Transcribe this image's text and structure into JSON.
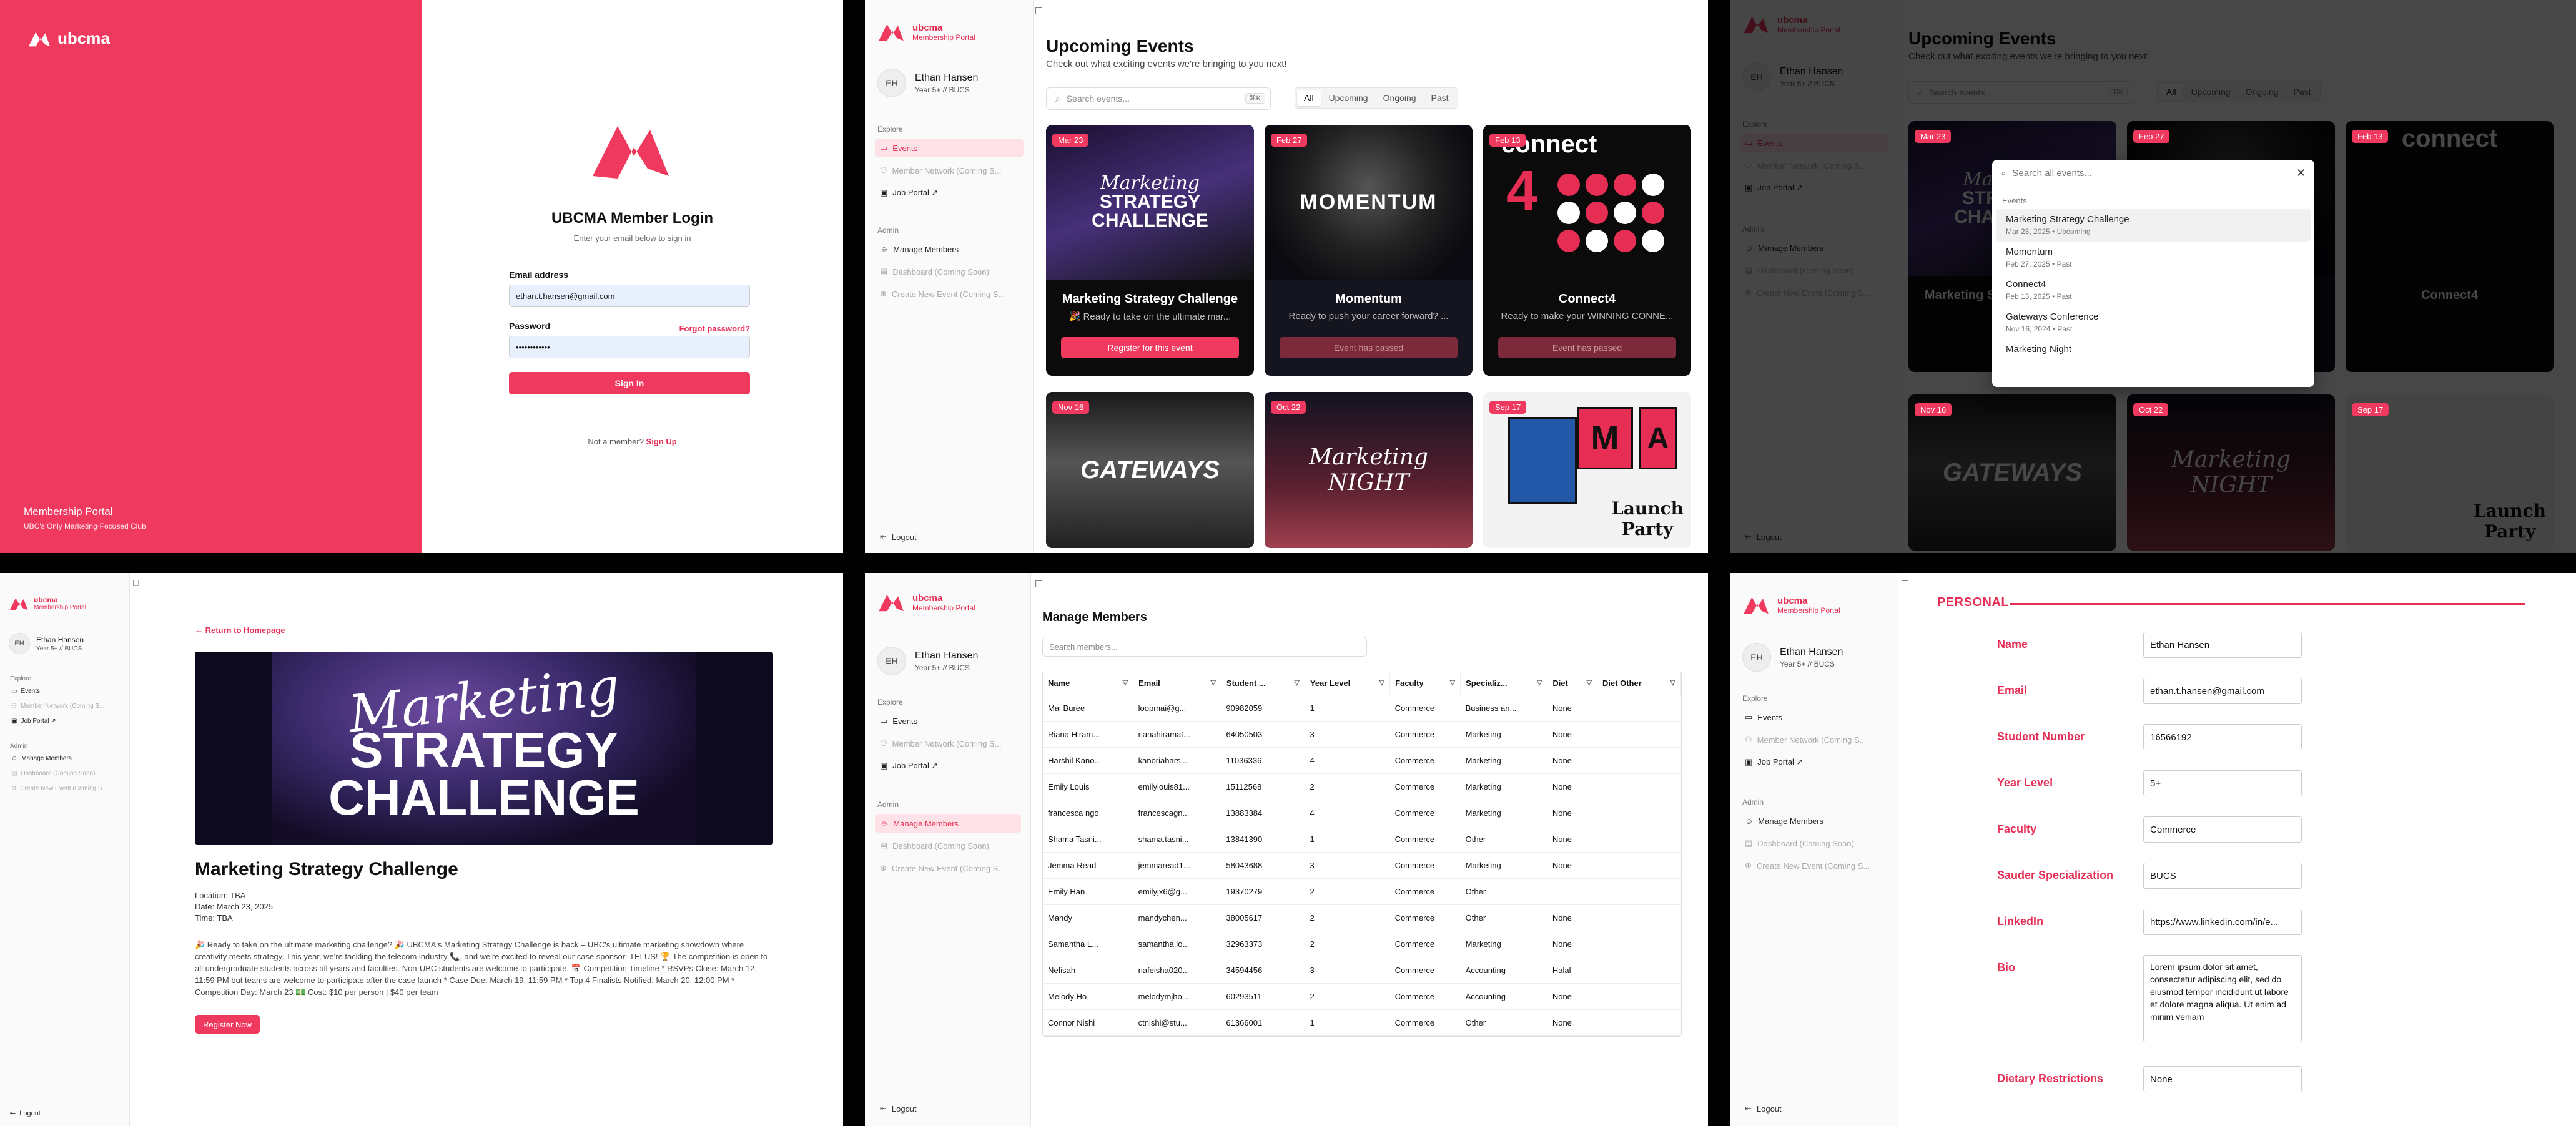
{
  "brand": {
    "name": "ubcma",
    "portal": "Membership Portal"
  },
  "colors": {
    "accent": "#f0395e"
  },
  "login": {
    "tagline_title": "Membership Portal",
    "tagline_sub": "UBC's Only Marketing-Focused Club",
    "title": "UBCMA Member Login",
    "subtitle": "Enter your email below to sign in",
    "email_label": "Email address",
    "email_value": "ethan.t.hansen@gmail.com",
    "password_label": "Password",
    "password_value": "••••••••••••",
    "forgot": "Forgot password?",
    "sign_in": "Sign In",
    "not_member": "Not a member?",
    "sign_up": "Sign Up"
  },
  "user": {
    "initials": "EH",
    "name": "Ethan Hansen",
    "sub": "Year 5+ // BUCS"
  },
  "nav": {
    "explore": "Explore",
    "events": "Events",
    "network": "Member Network (Coming S...",
    "jobs": "Job Portal ↗",
    "admin": "Admin",
    "manage": "Manage Members",
    "dashboard": "Dashboard (Coming Soon)",
    "create": "Create New Event (Coming S...",
    "logout": "Logout"
  },
  "events_page": {
    "title": "Upcoming Events",
    "subtitle": "Check out what exciting events we're bringing to you next!",
    "search_placeholder": "Search events...",
    "shortcut": "⌘K",
    "filters": [
      "All",
      "Upcoming",
      "Ongoing",
      "Past"
    ],
    "cards": [
      {
        "date": "Mar 23",
        "title": "Marketing Strategy Challenge",
        "desc": "🎉 Ready to take on the ultimate mar...",
        "button": "Register for this event",
        "art": "Marketing STRATEGY CHALLENGE"
      },
      {
        "date": "Feb 27",
        "title": "Momentum",
        "desc": "Ready to push your career forward? ...",
        "button": "Event has passed",
        "art": "MOMENTUM"
      },
      {
        "date": "Feb 13",
        "title": "Connect4",
        "desc": "Ready to make your WINNING CONNE...",
        "button": "Event has passed",
        "art": "connect 4"
      },
      {
        "date": "Nov 16",
        "art": "GATEWAYS"
      },
      {
        "date": "Oct 22",
        "art": "Marketing NIGHT"
      },
      {
        "date": "Sep 17",
        "art": "Launch Party"
      }
    ]
  },
  "search_modal": {
    "placeholder": "Search all events...",
    "section": "Events",
    "items": [
      {
        "title": "Marketing Strategy Challenge",
        "meta": "Mar 23, 2025 • Upcoming"
      },
      {
        "title": "Momentum",
        "meta": "Feb 27, 2025 • Past"
      },
      {
        "title": "Connect4",
        "meta": "Feb 13, 2025 • Past"
      },
      {
        "title": "Gateways Conference",
        "meta": "Nov 16, 2024 • Past"
      },
      {
        "title": "Marketing Night",
        "meta": ""
      }
    ]
  },
  "detail": {
    "back": "← Return to Homepage",
    "banner_script": "Marketing",
    "banner_block1": "STRATEGY",
    "banner_block2": "CHALLENGE",
    "title": "Marketing Strategy Challenge",
    "location": "Location: TBA",
    "date": "Date: March 23, 2025",
    "time": "Time: TBA",
    "description": "🎉 Ready to take on the ultimate marketing challenge? 🎉 UBCMA's Marketing Strategy Challenge is back – UBC's ultimate marketing showdown where creativity meets strategy. This year, we're tackling the telecom industry 📞, and we're excited to reveal our case sponsor: TELUS! 🏆 The competition is open to all undergraduate students across all years and faculties. Non-UBC students are welcome to participate. 📅 Competition Timeline * RSVPs Close: March 12, 11:59 PM but teams are welcome to participate after the case launch * Case Due: March 19, 11:59 PM * Top 4 Finalists Notified: March 20, 12:00 PM * Competition Day: March 23 💵 Cost: $10 per person | $40 per team",
    "register": "Register Now"
  },
  "members": {
    "title": "Manage Members",
    "search_placeholder": "Search members...",
    "columns": [
      "Name",
      "Email",
      "Student ...",
      "Year Level",
      "Faculty",
      "Specializ...",
      "Diet",
      "Diet Other"
    ],
    "rows": [
      [
        "Mai Buree",
        "loopmai@g...",
        "90982059",
        "1",
        "Commerce",
        "Business an...",
        "None",
        ""
      ],
      [
        "Riana Hiram...",
        "rianahiramat...",
        "64050503",
        "3",
        "Commerce",
        "Marketing",
        "None",
        ""
      ],
      [
        "Harshil Kano...",
        "kanoriahars...",
        "11036336",
        "4",
        "Commerce",
        "Marketing",
        "None",
        ""
      ],
      [
        "Emily Louis",
        "emilylouis81...",
        "15112568",
        "2",
        "Commerce",
        "Marketing",
        "None",
        ""
      ],
      [
        "francesca ngo",
        "francescagn...",
        "13883384",
        "4",
        "Commerce",
        "Marketing",
        "None",
        ""
      ],
      [
        "Shama Tasni...",
        "shama.tasni...",
        "13841390",
        "1",
        "Commerce",
        "Other",
        "None",
        ""
      ],
      [
        "Jemma Read",
        "jemmaread1...",
        "58043688",
        "3",
        "Commerce",
        "Marketing",
        "None",
        ""
      ],
      [
        "Emily Han",
        "emilyjx6@g...",
        "19370279",
        "2",
        "Commerce",
        "Other",
        "",
        ""
      ],
      [
        "Mandy",
        "mandychen...",
        "38005617",
        "2",
        "Commerce",
        "Other",
        "None",
        ""
      ],
      [
        "Samantha L...",
        "samantha.lo...",
        "32963373",
        "2",
        "Commerce",
        "Marketing",
        "None",
        ""
      ],
      [
        "Nefisah",
        "nafeisha020...",
        "34594456",
        "3",
        "Commerce",
        "Accounting",
        "Halal",
        ""
      ],
      [
        "Melody Ho",
        "melodymjho...",
        "60293511",
        "2",
        "Commerce",
        "Accounting",
        "None",
        ""
      ],
      [
        "Connor Nishi",
        "ctnishi@stu...",
        "61366001",
        "1",
        "Commerce",
        "Other",
        "None",
        ""
      ]
    ]
  },
  "profile": {
    "section": "PERSONAL",
    "fields": [
      {
        "label": "Name",
        "value": "Ethan Hansen"
      },
      {
        "label": "Email",
        "value": "ethan.t.hansen@gmail.com"
      },
      {
        "label": "Student Number",
        "value": "16566192"
      },
      {
        "label": "Year Level",
        "value": "5+"
      },
      {
        "label": "Faculty",
        "value": "Commerce"
      },
      {
        "label": "Sauder Specialization",
        "value": "BUCS"
      },
      {
        "label": "LinkedIn",
        "value": "https://www.linkedin.com/in/e..."
      },
      {
        "label": "Bio",
        "value": "Lorem ipsum dolor sit amet, consectetur adipiscing elit, sed do eiusmod tempor incididunt ut labore et dolore magna aliqua. Ut enim ad minim veniam"
      },
      {
        "label": "Dietary Restrictions",
        "value": "None"
      }
    ]
  }
}
